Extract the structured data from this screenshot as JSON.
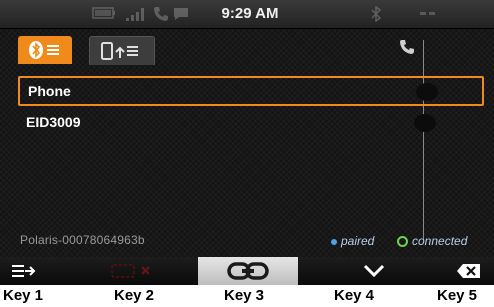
{
  "status": {
    "time": "9:29 AM"
  },
  "tabs": [
    {
      "name": "bluetooth-devices",
      "active": true
    },
    {
      "name": "phone-contacts-transfer",
      "active": false
    }
  ],
  "devices": [
    {
      "name": "Phone",
      "selected": true
    },
    {
      "name": "EID3009",
      "selected": false
    }
  ],
  "footer": {
    "device_name": "Polaris-00078064963b",
    "legend_paired": "paired",
    "legend_connected": "connected"
  },
  "softkeys": [
    {
      "icon": "list-arrow-icon"
    },
    {
      "icon": "disconnect-icon",
      "disabled": true
    },
    {
      "icon": "link-icon",
      "active": true
    },
    {
      "icon": "chevron-down-icon"
    },
    {
      "icon": "backspace-icon"
    }
  ],
  "key_labels": [
    "Key 1",
    "Key 2",
    "Key 3",
    "Key 4",
    "Key 5"
  ],
  "colors": {
    "accent": "#f08a1a",
    "paired": "#4aa3e8",
    "connected": "#6fd24a"
  }
}
